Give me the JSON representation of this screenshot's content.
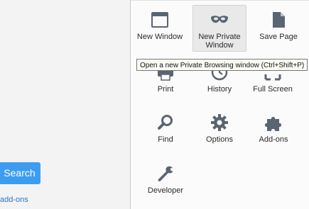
{
  "page": {
    "search_button": "Search",
    "addons_link": "add-ons"
  },
  "menu": {
    "items": [
      {
        "label": "New Window",
        "icon": "window-icon"
      },
      {
        "label": "New Private\nWindow",
        "icon": "private-mask-icon"
      },
      {
        "label": "Save Page",
        "icon": "document-icon"
      },
      {
        "label": "Print",
        "icon": "printer-icon"
      },
      {
        "label": "History",
        "icon": "history-icon"
      },
      {
        "label": "Full Screen",
        "icon": "fullscreen-icon"
      },
      {
        "label": "Find",
        "icon": "magnifier-icon"
      },
      {
        "label": "Options",
        "icon": "gear-icon"
      },
      {
        "label": "Add-ons",
        "icon": "puzzle-icon"
      },
      {
        "label": "Developer",
        "icon": "wrench-icon"
      }
    ],
    "tooltip": "Open a new Private Browsing window (Ctrl+Shift+P)"
  },
  "colors": {
    "accent": "#3c9df0",
    "icon": "#5a6573",
    "link": "#2d74c4"
  }
}
